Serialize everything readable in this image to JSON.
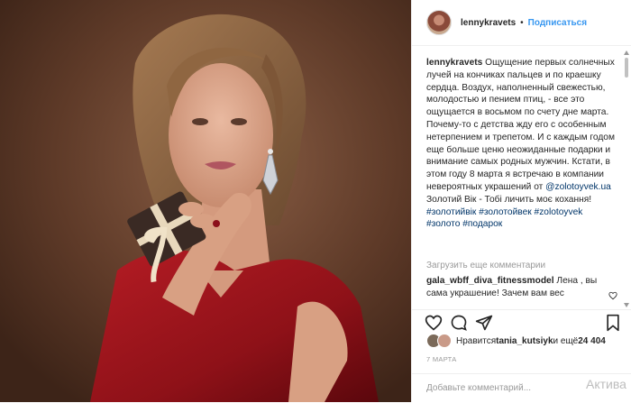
{
  "header": {
    "username": "lennykravets",
    "separator": "•",
    "follow_label": "Подписаться"
  },
  "caption": {
    "username": "lennykravets",
    "text": "Ощущение первых солнечных лучей на кончиках пальцев и по краешку сердца. Воздух, наполненный свежестью, молодостью и пением птиц, - все это ощущается в восьмом по счету дне марта. Почему-то с детства жду его с особенным нетерпением и трепетом. И с каждым годом еще больше ценю неожиданные подарки и внимание самых родных мужчин. Кстати, в этом году 8 марта я встречаю в компании невероятных украшений от ",
    "mention": "@zolotoyvek.ua",
    "line2": "Золотий Вік - Тобі личить моє кохання!",
    "hashtags": [
      "#золотийвік",
      "#золотойвек",
      "#zolotoyvek",
      "#золото",
      "#подарок"
    ]
  },
  "load_more": "Загрузить еще комментарии",
  "comment": {
    "username": "gala_wbff_diva_fitnessmodel",
    "text": " Лена , вы сама украшение! Зачем вам вес"
  },
  "likes": {
    "prefix": "Нравится ",
    "user": "tania_kutsiyk",
    "mid": " и ещё ",
    "count": "24 404"
  },
  "date": "7 МАРТА",
  "add_comment_placeholder": "Добавьте комментарий...",
  "watermark": "Актива",
  "icons": [
    "heart-icon",
    "comment-icon",
    "share-icon",
    "bookmark-icon"
  ],
  "colors": {
    "accent": "#3897f0",
    "link": "#003569",
    "muted": "#999999"
  }
}
